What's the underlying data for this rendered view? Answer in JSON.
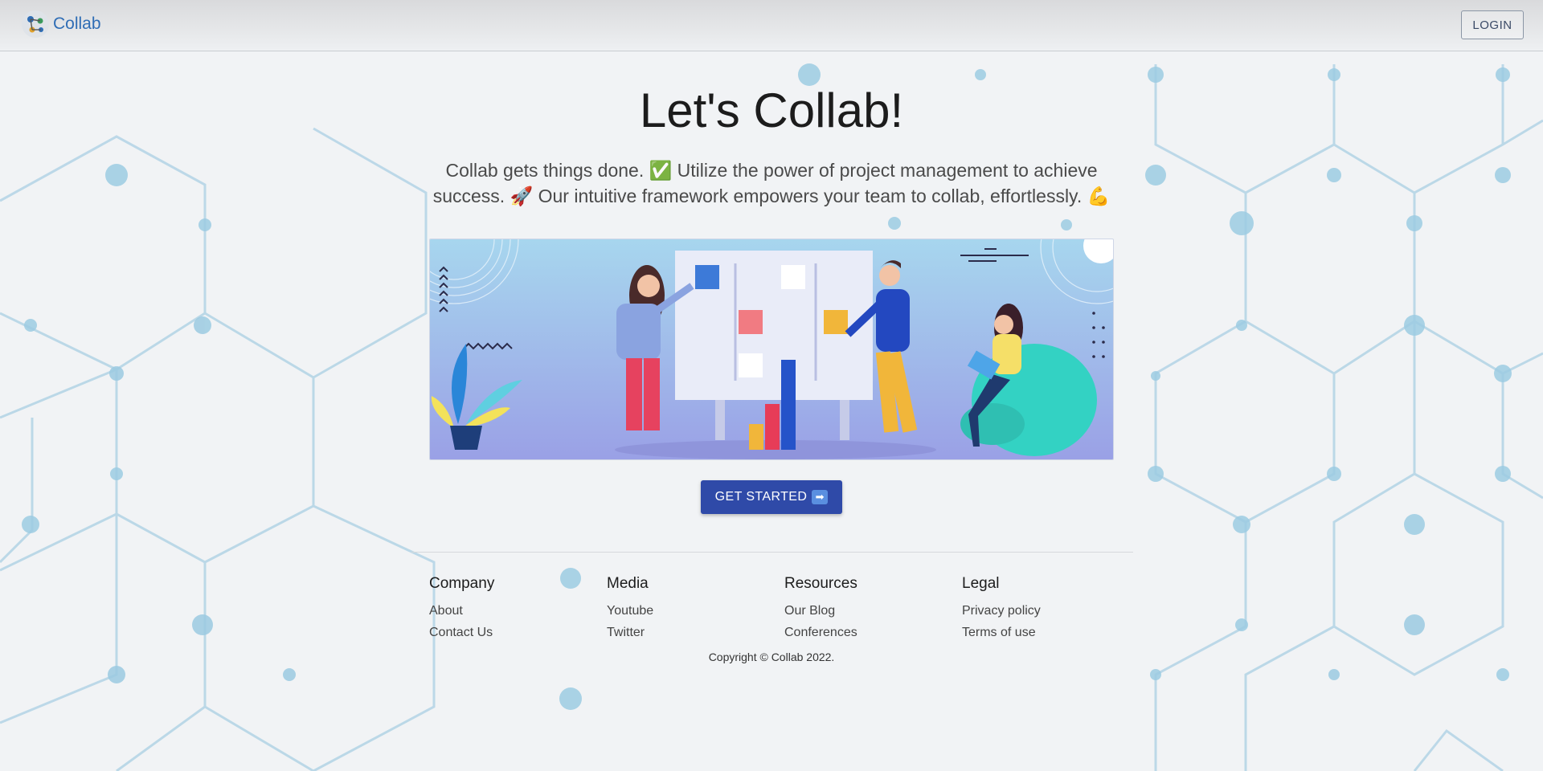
{
  "header": {
    "brand": "Collab",
    "login_label": "LOGIN"
  },
  "hero": {
    "title": "Let's Collab!",
    "subtitle": "Collab gets things done. ✅ Utilize the power of project management to achieve success. 🚀 Our intuitive framework empowers your team to collab, effortlessly. 💪",
    "cta_label": "GET STARTED",
    "cta_icon": "➡"
  },
  "footer": {
    "columns": [
      {
        "title": "Company",
        "links": [
          "About",
          "Contact Us"
        ]
      },
      {
        "title": "Media",
        "links": [
          "Youtube",
          "Twitter"
        ]
      },
      {
        "title": "Resources",
        "links": [
          "Our Blog",
          "Conferences"
        ]
      },
      {
        "title": "Legal",
        "links": [
          "Privacy policy",
          "Terms of use"
        ]
      }
    ],
    "copyright": "Copyright © Collab 2022."
  },
  "colors": {
    "brand": "#2f6db5",
    "cta": "#2f4aa8",
    "hex_lines": "#a9cfe3"
  },
  "icons": {
    "brand_logo": "collab-logo-icon",
    "cta_arrow": "arrow-right-icon"
  }
}
